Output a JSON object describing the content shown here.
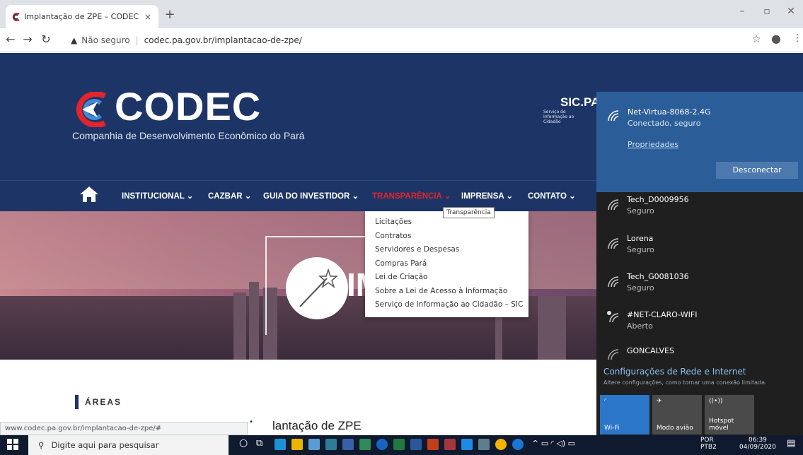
{
  "browser": {
    "tab_title": "Implantação de ZPE – CODEC",
    "tab_close": "×",
    "new_tab": "+",
    "security_label": "Não seguro",
    "url": "codec.pa.gov.br/implantacao-de-zpe/",
    "back_icon": "arrow-left-icon",
    "forward_icon": "arrow-right-icon",
    "reload_icon": "reload-icon"
  },
  "site": {
    "logo_text": "CODEC",
    "logo_subtitle": "Companhia de Desenvolvimento Econômico do Pará",
    "sic_title": "SIC.PA",
    "sic_subtitle": "Serviço de Informação ao Cidadão",
    "nav": [
      {
        "label": "INSTITUCIONAL ⌄"
      },
      {
        "label": "CAZBAR ⌄"
      },
      {
        "label": "GUIA DO INVESTIDOR ⌄"
      },
      {
        "label": "TRANSPARÊNCIA ⌄"
      },
      {
        "label": "IMPRENSA ⌄"
      },
      {
        "label": "CONTATO ⌄"
      }
    ],
    "hero_text": "IM",
    "tooltip": "Transparência",
    "dropdown": [
      "Licitações",
      "Contratos",
      "Servidores e Despesas",
      "Compras Pará",
      "Lei de Criação",
      "Sobre a Lei de Acesso à Informação",
      "Serviço de Informação ao Cidadão – SIC"
    ],
    "areas_label": "ÁREAS",
    "heading": "lantação de ZPE",
    "status_url": "www.codec.pa.gov.br/implantacao-de-zpe/#"
  },
  "wifi": {
    "connected": {
      "name": "Net-Virtua-8068-2.4G",
      "status": "Conectado, seguro"
    },
    "properties_label": "Propriedades",
    "disconnect_label": "Desconectar",
    "networks": [
      {
        "name": "Tech_D0009956",
        "status": "Seguro"
      },
      {
        "name": "Lorena",
        "status": "Seguro"
      },
      {
        "name": "Tech_G0081036",
        "status": "Seguro"
      },
      {
        "name": "#NET-CLARO-WIFI",
        "status": "Aberto"
      },
      {
        "name": "GONCALVES",
        "status": ""
      }
    ],
    "settings_title": "Configurações de Rede e Internet",
    "settings_subtitle": "Altere configurações, como tornar uma conexão limitada.",
    "quick_actions": [
      {
        "label": "Wi-Fi",
        "color": "#2b76c9"
      },
      {
        "label": "Modo avião",
        "color": "#4a4a4a"
      },
      {
        "label": "Hotspot móvel",
        "color": "#4a4a4a"
      }
    ]
  },
  "taskbar": {
    "search_placeholder": "Digite aqui para pesquisar",
    "lang_top": "POR",
    "lang_bottom": "PTB2",
    "time": "06:39",
    "date": "04/09/2020"
  },
  "colors": {
    "header_blue": "#1d3566",
    "accent_red": "#e2242d",
    "wifi_blue": "#2b5e98"
  }
}
